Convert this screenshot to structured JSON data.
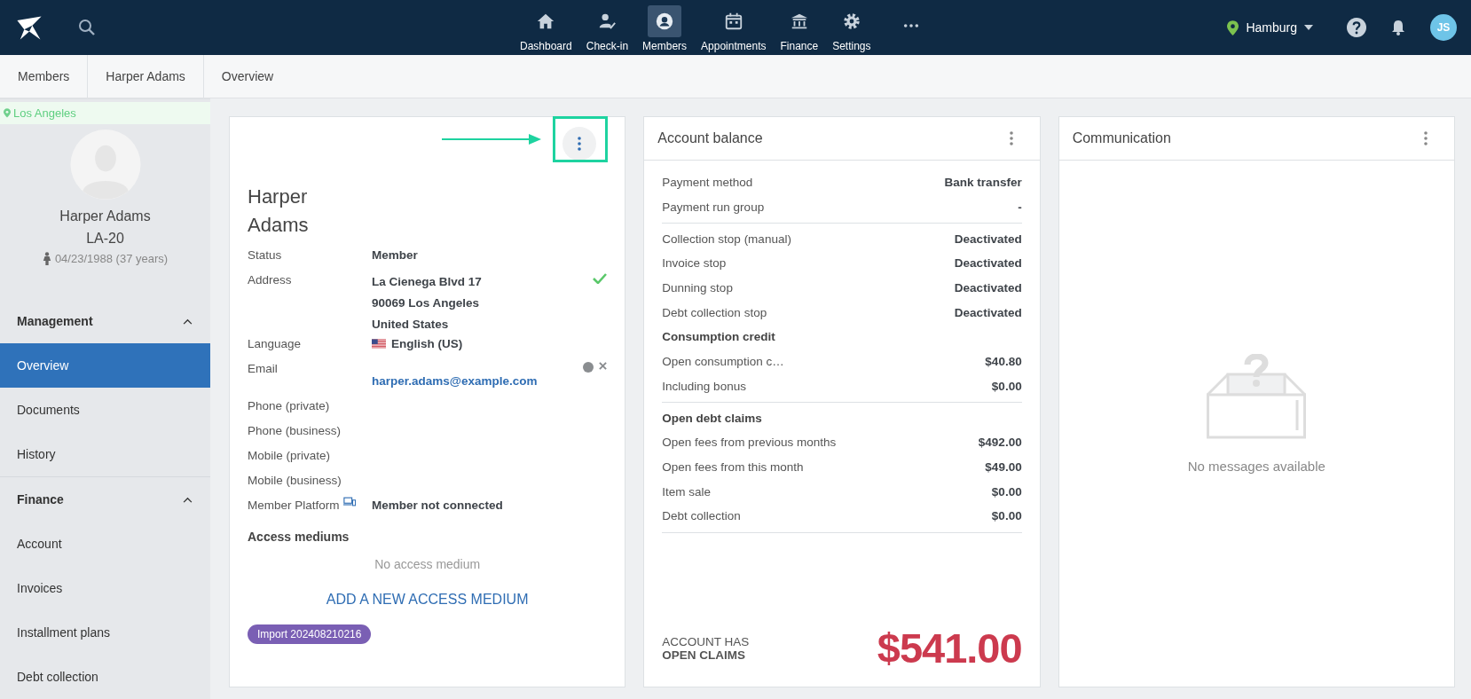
{
  "nav": {
    "items": [
      {
        "label": "Dashboard",
        "selected": false
      },
      {
        "label": "Check-in",
        "selected": false
      },
      {
        "label": "Members",
        "selected": true
      },
      {
        "label": "Appointments",
        "selected": false
      },
      {
        "label": "Finance",
        "selected": false
      },
      {
        "label": "Settings",
        "selected": false
      }
    ],
    "location": "Hamburg",
    "avatar": "JS"
  },
  "breadcrumbs": [
    "Members",
    "Harper Adams",
    "Overview"
  ],
  "sidebar": {
    "location": "Los Angeles",
    "name": "Harper Adams",
    "member_id": "LA-20",
    "birth": "04/23/1988 (37 years)",
    "sections": [
      {
        "title": "Management",
        "expanded": true,
        "items": [
          {
            "label": "Overview",
            "selected": true
          },
          {
            "label": "Documents",
            "selected": false
          },
          {
            "label": "History",
            "selected": false
          }
        ]
      },
      {
        "title": "Finance",
        "expanded": true,
        "items": [
          {
            "label": "Account",
            "selected": false
          },
          {
            "label": "Invoices",
            "selected": false
          },
          {
            "label": "Installment plans",
            "selected": false
          },
          {
            "label": "Debt collection",
            "selected": false
          }
        ]
      }
    ]
  },
  "member_card": {
    "highlighted": true,
    "name": "Harper Adams",
    "fields": [
      {
        "label": "Status",
        "kind": "text",
        "values": [
          "Member"
        ]
      },
      {
        "label": "Address",
        "kind": "address",
        "verified": true,
        "values": [
          "La Cienega Blvd 17",
          "90069 Los Angeles",
          "United States"
        ]
      },
      {
        "label": "Language",
        "kind": "language",
        "values": [
          "English (US)"
        ]
      },
      {
        "label": "Email",
        "kind": "email",
        "values": [
          "harper.adams@example.com"
        ]
      },
      {
        "label": "Phone (private)",
        "kind": "text"
      },
      {
        "label": "Phone (business)",
        "kind": "text"
      },
      {
        "label": "Mobile (private)",
        "kind": "text"
      },
      {
        "label": "Mobile (business)",
        "kind": "text"
      },
      {
        "label": "Member Platform",
        "kind": "platform",
        "values": [
          "Member not connected"
        ]
      }
    ],
    "access_title": "Access mediums",
    "access_empty": "No access medium",
    "add_button": "ADD A NEW ACCESS MEDIUM",
    "tag": "Import 202408210216"
  },
  "account": {
    "title": "Account balance",
    "groups": [
      [
        {
          "kind": "row",
          "label": "Payment method",
          "value": "Bank transfer"
        },
        {
          "kind": "row",
          "label": "Payment run group",
          "value": "-"
        }
      ],
      [
        {
          "kind": "row",
          "label": "Collection stop (manual)",
          "value": "Deactivated"
        },
        {
          "kind": "row",
          "label": "Invoice stop",
          "value": "Deactivated"
        },
        {
          "kind": "row",
          "label": "Dunning stop",
          "value": "Deactivated"
        },
        {
          "kind": "row",
          "label": "Debt collection stop",
          "value": "Deactivated"
        },
        {
          "kind": "heading",
          "label": "Consumption credit"
        },
        {
          "kind": "row",
          "label": "Open consumption c…",
          "value": "$40.80"
        },
        {
          "kind": "row",
          "label": "Including bonus",
          "value": "$0.00"
        }
      ],
      [
        {
          "kind": "heading",
          "label": "Open debt claims"
        },
        {
          "kind": "row",
          "label": "Open fees from previous months",
          "value": "$492.00"
        },
        {
          "kind": "row",
          "label": "Open fees from this month",
          "value": "$49.00"
        },
        {
          "kind": "row",
          "label": "Item sale",
          "value": "$0.00"
        },
        {
          "kind": "row",
          "label": "Debt collection",
          "value": "$0.00"
        }
      ]
    ],
    "summary_lines": [
      "ACCOUNT HAS",
      "OPEN CLAIMS"
    ],
    "amount": "$541.00"
  },
  "communication": {
    "title": "Communication",
    "empty": "No messages available"
  }
}
